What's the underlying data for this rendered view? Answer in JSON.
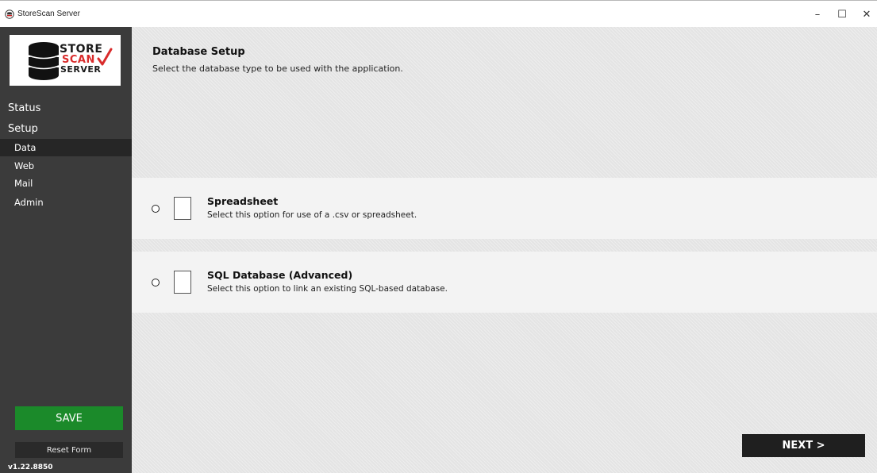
{
  "window": {
    "title": "StoreScan Server",
    "app_icon": "storescan-app-icon",
    "controls": {
      "minimize": "–",
      "maximize": "☐",
      "close": "✕"
    }
  },
  "sidebar": {
    "logo": {
      "line1": "STORE",
      "line2": "SCAN",
      "line3": "SERVER",
      "icon": "database-check-icon"
    },
    "nav": {
      "status": "Status",
      "setup": "Setup",
      "items": [
        "Data",
        "Web",
        "Mail",
        "Admin"
      ],
      "selected": "Data"
    },
    "save_label": "SAVE",
    "reset_label": "Reset Form",
    "version": "v1.22.8850"
  },
  "main": {
    "title": "Database Setup",
    "description": "Select the database type to be used with the application.",
    "options": [
      {
        "title": "Spreadsheet",
        "description": "Select this option for use of a .csv or spreadsheet.",
        "selected": false,
        "icon": "document-icon"
      },
      {
        "title": "SQL Database (Advanced)",
        "description": "Select this option to link an existing SQL-based database.",
        "selected": false,
        "icon": "document-icon"
      }
    ],
    "next_label": "NEXT >"
  },
  "colors": {
    "sidebar_bg": "#3b3b3b",
    "sidebar_selected": "#262626",
    "save_green": "#1b8a2a",
    "logo_red": "#d92b2b",
    "next_bg": "#1f1f1f"
  }
}
